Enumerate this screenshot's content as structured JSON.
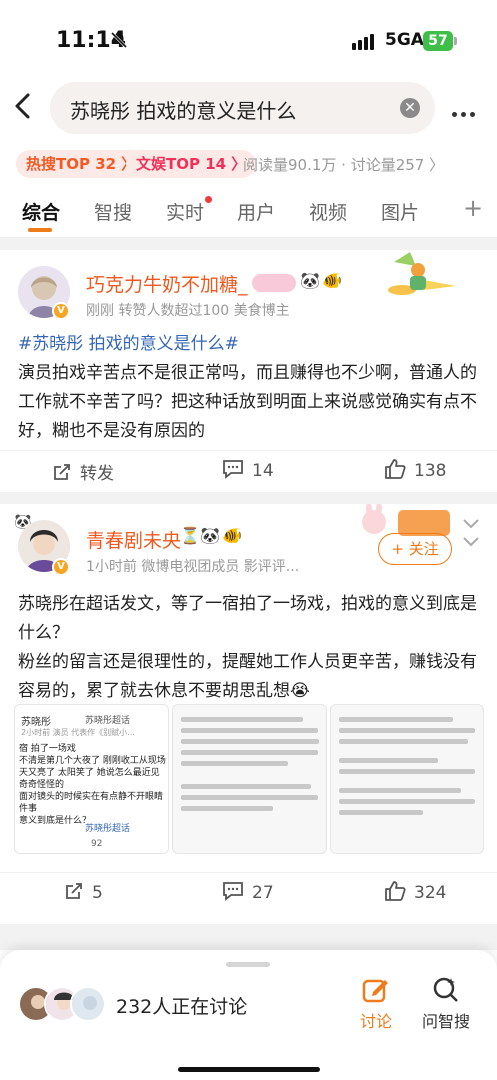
{
  "status_bar": {
    "time": "11:14",
    "network": "5GA",
    "battery": "57"
  },
  "search": {
    "query": "苏晓彤 拍戏的意义是什么"
  },
  "hot_tags": {
    "hot": "热搜TOP 32 〉",
    "ent": "文娱TOP 14 〉",
    "read_info": "阅读量90.1万 · 讨论量257 〉"
  },
  "tabs": [
    "综合",
    "智搜",
    "实时",
    "用户",
    "视频",
    "图片"
  ],
  "posts": [
    {
      "username": "巧克力牛奶不加糖_",
      "meta": "刚刚  转赞人数超过100  美食博主",
      "topic": "#苏晓彤 拍戏的意义是什么#",
      "text": "演员拍戏辛苦点不是很正常吗，而且赚得也不少啊，普通人的工作就不辛苦了吗？把这种话放到明面上来说感觉确实有点不好，糊也不是没有原因的",
      "repost_label": "转发",
      "comments": "14",
      "likes": "138"
    },
    {
      "username": "青春剧未央",
      "meta": "1小时前  微博电视团成员  影评评...",
      "follow": "+ 关注",
      "text1": "苏晓彤在超话发文，等了一宿拍了一场戏，拍戏的意义到底是什么？",
      "text2": "粉丝的留言还是很理性的，提醒她工作人员更辛苦，赚钱没有容易的，累了就去休息不要胡思乱想😭",
      "image1": {
        "user": "苏晓彤",
        "tag": "苏晓彤超话",
        "meta": "2小时前  演员 代表作《别赋小...",
        "lines": [
          "宿 拍了一场戏",
          "不清是第几个大夜了 刚刚收工从现场",
          "天又亮了 太阳笑了 她说怎么最近见",
          "奇奇怪怪的",
          "面对镜头的时候实在有点静不开眼睛",
          "件事",
          "意义到底是什么？"
        ],
        "footer_tag": "苏晓彤超话",
        "footer_count": "92"
      },
      "reposts": "5",
      "comments": "27",
      "likes": "324"
    }
  ],
  "bottom": {
    "discuss_count": "232人正在讨论",
    "btn1": "讨论",
    "btn2": "问智搜"
  }
}
